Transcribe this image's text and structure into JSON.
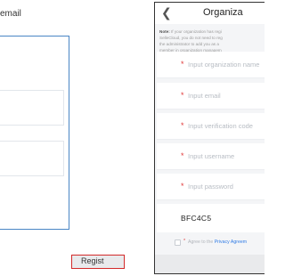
{
  "left_panel": {
    "caption": "email"
  },
  "header": {
    "title": "Organiza"
  },
  "note": {
    "label": "Note:",
    "line1": "If your organization has regi",
    "line2": "SelleCloud, you do not need to reg",
    "line3": "the administrator to add you as a",
    "line4": "member in organization managem"
  },
  "form": {
    "fields": [
      {
        "placeholder": "Input organization name"
      },
      {
        "placeholder": "Input email"
      },
      {
        "placeholder": "Input verification code"
      },
      {
        "placeholder": "Input username"
      },
      {
        "placeholder": "Input password"
      }
    ],
    "captcha_code": "BFC4C5",
    "agree_text": "Agree to the",
    "privacy_link": "Privacy Agreem"
  },
  "actions": {
    "register_label": "Regist"
  },
  "colors": {
    "accent_blue": "#4a86c5",
    "required_red": "#e13b3b",
    "highlight_red": "#d22a2a",
    "link_blue": "#2f7be5"
  }
}
